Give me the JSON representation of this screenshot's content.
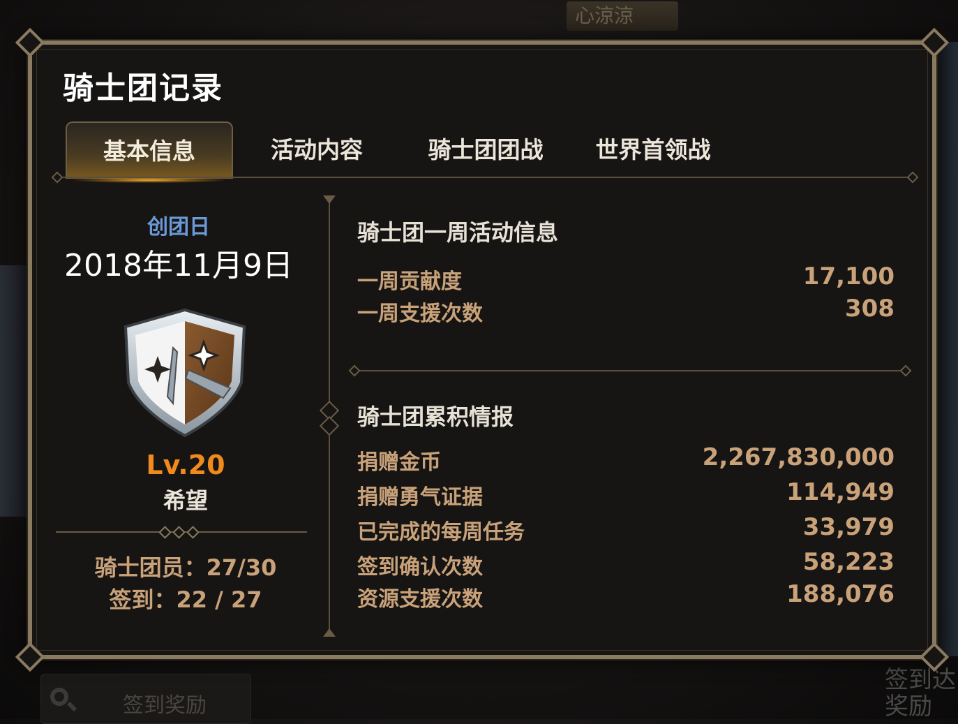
{
  "background": {
    "player_name": "心涼涼",
    "bottom_button_label": "签到奖励",
    "corner_text": "签到达 奖励"
  },
  "window": {
    "title": "骑士团记录"
  },
  "tabs": [
    {
      "label": "基本信息",
      "active": true
    },
    {
      "label": "活动内容",
      "active": false
    },
    {
      "label": "骑士团团战",
      "active": false
    },
    {
      "label": "世界首领战",
      "active": false
    }
  ],
  "guild": {
    "found_label": "创团日",
    "found_date": "2018年11月9日",
    "emblem_icon": "shield-emblem-icon",
    "level": "Lv.20",
    "name": "希望",
    "members": "骑士团员：27/30",
    "checkin": "签到：22 / 27"
  },
  "weekly": {
    "title": "骑士团一周活动信息",
    "rows": [
      {
        "label": "一周贡献度",
        "value": "17,100"
      },
      {
        "label": "一周支援次数",
        "value": "308"
      }
    ]
  },
  "cumulative": {
    "title": "骑士团累积情报",
    "rows": [
      {
        "label": "捐赠金币",
        "value": "2,267,830,000"
      },
      {
        "label": "捐赠勇气证据",
        "value": "114,949"
      },
      {
        "label": "已完成的每周任务",
        "value": "33,979"
      },
      {
        "label": "签到确认次数",
        "value": "58,223"
      },
      {
        "label": "资源支援次数",
        "value": "188,076"
      }
    ]
  },
  "colors": {
    "accent_orange": "#f08a1c",
    "label_tan": "#c9a27a",
    "found_blue": "#6a9ad8",
    "frame_gold": "#8a7a60"
  }
}
